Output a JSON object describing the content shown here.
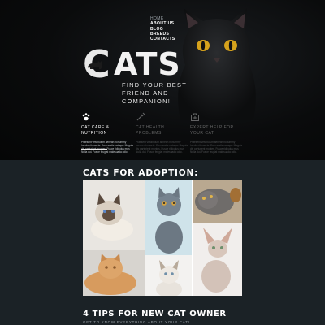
{
  "nav": {
    "items": [
      {
        "label": "HOME",
        "active": false
      },
      {
        "label": "ABOUT US",
        "active": true
      },
      {
        "label": "BLOG",
        "active": true
      },
      {
        "label": "BREEDS",
        "active": true
      },
      {
        "label": "CONTACTS",
        "active": true
      }
    ]
  },
  "logo": {
    "letter_c": "C",
    "letters_ats": "ATS"
  },
  "tagline": "FIND YOUR BEST FRIEND AND COMPANION!",
  "features": [
    {
      "icon": "paw-icon",
      "title": "CAT CARE & NUTRITION",
      "text": "Praesent vestibulum aenean nonummy hendrerit mauris. Cum sociis natoque Magnis dis parturient montes. Fusce ridiculus mus Nulla dui. Fusce feugiat malesuada odio."
    },
    {
      "icon": "syringe-icon",
      "title": "CAT HEALTH PROBLEMS",
      "text": "Praesent vestibulum aenean nonummy hendrerit mauris. Cum sociis natoque Magnis dis parturient montes. Fusce ridiculus mus Nulla dui. Fusce feugiat malesuada odio."
    },
    {
      "icon": "medical-kit-icon",
      "title": "EXPERT HELP FOR YOUR CAT",
      "text": "Praesent vestibulum aenean nonummy hendrerit mauris. Cum sociis natoque Magnis dis parturient montes. Fusce ridiculus mus Nulla dui. Fusce feugiat malesuada odio."
    }
  ],
  "adoption": {
    "title": "CATS FOR ADOPTION:"
  },
  "tips": {
    "title": "4 TIPS FOR NEW CAT OWNER",
    "subtitle": "GET TO KNOW EVERYTHING ABOUT YOUR CAT!"
  },
  "colors": {
    "background": "#1b2226",
    "hero": "#0a0b0c",
    "text": "#ffffff",
    "muted": "#9aa2a8"
  }
}
